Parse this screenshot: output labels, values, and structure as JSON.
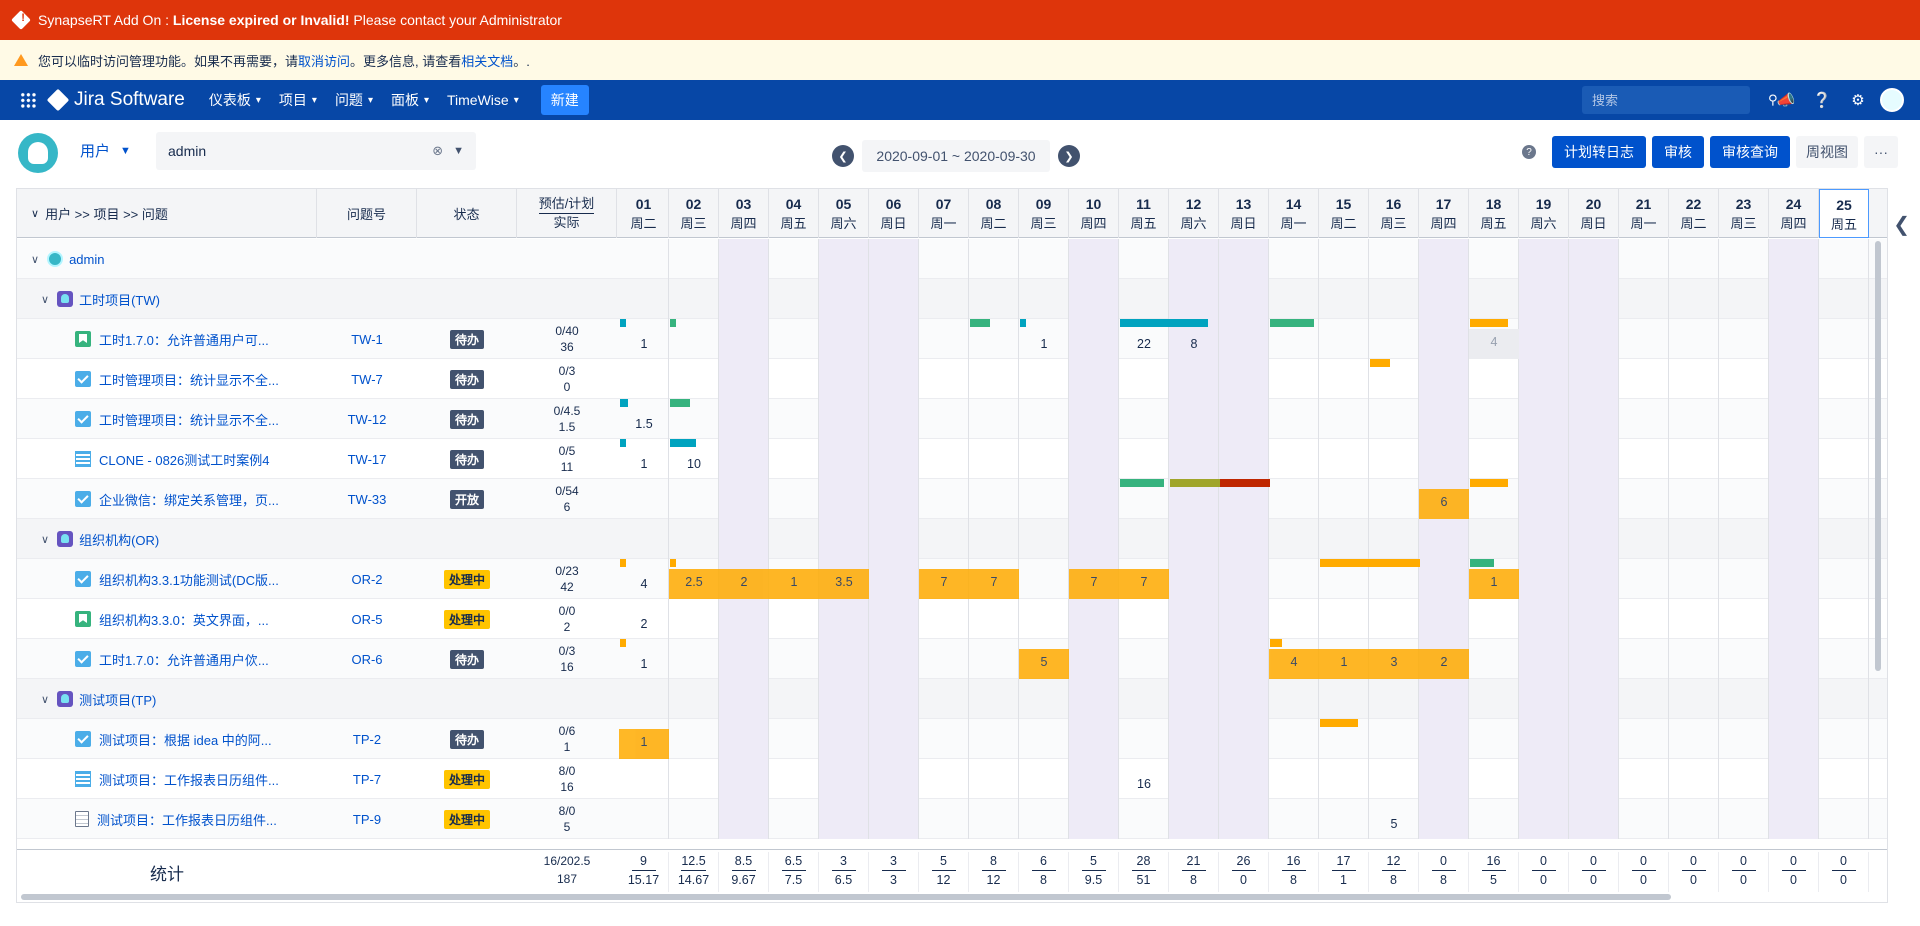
{
  "alerts": {
    "license_prefix": "SynapseRT Add On : ",
    "license_bold": "License expired or Invalid!",
    "license_suffix": " Please contact your Administrator",
    "temp_access_a": "您可以临时访问管理功能。如果不再需要，请 ",
    "temp_access_link1": "取消访问",
    "temp_access_b": "。更多信息, 请查看 ",
    "temp_access_link2": "相关文档",
    "temp_access_c": "。."
  },
  "nav": {
    "product": "Jira Software",
    "items": [
      "仪表板",
      "项目",
      "问题",
      "面板",
      "TimeWise"
    ],
    "create": "新建",
    "search_placeholder": "搜索"
  },
  "toolbar": {
    "user_mode": "用户",
    "user_value": "admin",
    "date_range": "2020-09-01 ~ 2020-09-30",
    "help": "?",
    "buttons": [
      "计划转日志",
      "审核",
      "审核查询"
    ],
    "week_view": "周视图",
    "more": "···"
  },
  "table": {
    "headers": {
      "tree": "用户 >> 项目 >> 问题",
      "key": "问题号",
      "status": "状态",
      "est_top": "预估/计划",
      "est_bottom": "实际"
    },
    "days": [
      {
        "d": "01",
        "w": "周二"
      },
      {
        "d": "02",
        "w": "周三"
      },
      {
        "d": "03",
        "w": "周四"
      },
      {
        "d": "04",
        "w": "周五"
      },
      {
        "d": "05",
        "w": "周六"
      },
      {
        "d": "06",
        "w": "周日"
      },
      {
        "d": "07",
        "w": "周一"
      },
      {
        "d": "08",
        "w": "周二"
      },
      {
        "d": "09",
        "w": "周三"
      },
      {
        "d": "10",
        "w": "周四"
      },
      {
        "d": "11",
        "w": "周五"
      },
      {
        "d": "12",
        "w": "周六"
      },
      {
        "d": "13",
        "w": "周日"
      },
      {
        "d": "14",
        "w": "周一"
      },
      {
        "d": "15",
        "w": "周二"
      },
      {
        "d": "16",
        "w": "周三"
      },
      {
        "d": "17",
        "w": "周四"
      },
      {
        "d": "18",
        "w": "周五"
      },
      {
        "d": "19",
        "w": "周六"
      },
      {
        "d": "20",
        "w": "周日"
      },
      {
        "d": "21",
        "w": "周一"
      },
      {
        "d": "22",
        "w": "周二"
      },
      {
        "d": "23",
        "w": "周三"
      },
      {
        "d": "24",
        "w": "周四"
      },
      {
        "d": "25",
        "w": "周五"
      }
    ],
    "rows": [
      {
        "kind": "user",
        "title": "admin"
      },
      {
        "kind": "project",
        "title": "工时项目(TW)"
      },
      {
        "kind": "issue",
        "type": "story",
        "title": "工时1.7.0：允许普通用户可...",
        "key": "TW-1",
        "status": "待办",
        "lz": "todo",
        "est": "0/40",
        "act": "36",
        "vals": {
          "0": "1",
          "8": "1",
          "10": "22",
          "11": "8"
        },
        "grey": {
          "17": "4"
        },
        "fills": [],
        "bars": [
          {
            "i": 0,
            "c": "teal",
            "w": 6
          },
          {
            "i": 1,
            "c": "green",
            "w": 6
          },
          {
            "i": 7,
            "c": "green",
            "w": 20
          },
          {
            "i": 8,
            "c": "teal",
            "w": 6
          },
          {
            "i": 10,
            "c": "teal",
            "w": 50
          },
          {
            "i": 11,
            "c": "teal",
            "w": 38
          },
          {
            "i": 13,
            "c": "green",
            "w": 44
          },
          {
            "i": 17,
            "c": "orange",
            "w": 38
          }
        ]
      },
      {
        "kind": "issue",
        "type": "task",
        "title": "工时管理项目：统计显示不全...",
        "key": "TW-7",
        "status": "待办",
        "lz": "todo",
        "est": "0/3",
        "act": "0",
        "vals": {},
        "grey": {},
        "fills": [],
        "bars": [
          {
            "i": 15,
            "c": "orange",
            "w": 20
          }
        ]
      },
      {
        "kind": "issue",
        "type": "task",
        "title": "工时管理项目：统计显示不全...",
        "key": "TW-12",
        "status": "待办",
        "lz": "todo",
        "est": "0/4.5",
        "act": "1.5",
        "vals": {
          "0": "1.5"
        },
        "grey": {},
        "fills": [],
        "bars": [
          {
            "i": 0,
            "c": "teal",
            "w": 8
          },
          {
            "i": 1,
            "c": "green",
            "w": 20
          }
        ]
      },
      {
        "kind": "issue",
        "type": "list",
        "title": "CLONE - 0826测试工时案例4",
        "key": "TW-17",
        "status": "待办",
        "lz": "todo",
        "est": "0/5",
        "act": "11",
        "vals": {
          "0": "1",
          "1": "10"
        },
        "grey": {},
        "fills": [],
        "bars": [
          {
            "i": 0,
            "c": "teal",
            "w": 6
          },
          {
            "i": 1,
            "c": "teal",
            "w": 26
          }
        ]
      },
      {
        "kind": "issue",
        "type": "task",
        "title": "企业微信：绑定关系管理，页...",
        "key": "TW-33",
        "status": "开放",
        "lz": "open",
        "est": "0/54",
        "act": "6",
        "vals": {},
        "grey": {},
        "fills": [
          {
            "i": 16,
            "v": "6"
          }
        ],
        "bars": [
          {
            "i": 10,
            "c": "green",
            "w": 44
          },
          {
            "i": 11,
            "c": "olive",
            "w": 50
          },
          {
            "i": 12,
            "c": "red",
            "w": 50
          },
          {
            "i": 17,
            "c": "orange",
            "w": 38
          }
        ]
      },
      {
        "kind": "project",
        "title": "组织机构(OR)"
      },
      {
        "kind": "issue",
        "type": "task",
        "title": "组织机构3.3.1功能测试(DC版...",
        "key": "OR-2",
        "status": "处理中",
        "lz": "prog",
        "est": "0/23",
        "act": "42",
        "vals": {
          "0": "4"
        },
        "grey": {},
        "fills": [
          {
            "i": 1,
            "v": "2.5"
          },
          {
            "i": 2,
            "v": "2"
          },
          {
            "i": 3,
            "v": "1"
          },
          {
            "i": 4,
            "v": "3.5"
          },
          {
            "i": 6,
            "v": "7"
          },
          {
            "i": 7,
            "v": "7"
          },
          {
            "i": 9,
            "v": "7"
          },
          {
            "i": 10,
            "v": "7"
          },
          {
            "i": 17,
            "v": "1"
          }
        ],
        "bars": [
          {
            "i": 0,
            "c": "orange",
            "w": 6
          },
          {
            "i": 1,
            "c": "orange",
            "w": 6
          },
          {
            "i": 14,
            "c": "orange",
            "w": 50
          },
          {
            "i": 15,
            "c": "orange",
            "w": 50
          },
          {
            "i": 17,
            "c": "green",
            "w": 24
          }
        ]
      },
      {
        "kind": "issue",
        "type": "story",
        "title": "组织机构3.3.0：英文界面，...",
        "key": "OR-5",
        "status": "处理中",
        "lz": "prog",
        "est": "0/0",
        "act": "2",
        "vals": {
          "0": "2"
        },
        "grey": {},
        "fills": [],
        "bars": []
      },
      {
        "kind": "issue",
        "type": "task",
        "title": "工时1.7.0：允许普通用户佽...",
        "key": "OR-6",
        "status": "待办",
        "lz": "todo",
        "est": "0/3",
        "act": "16",
        "vals": {
          "0": "1"
        },
        "grey": {},
        "fills": [
          {
            "i": 8,
            "v": "5"
          },
          {
            "i": 13,
            "v": "4"
          },
          {
            "i": 14,
            "v": "1"
          },
          {
            "i": 15,
            "v": "3"
          },
          {
            "i": 16,
            "v": "2"
          }
        ],
        "bars": [
          {
            "i": 0,
            "c": "orange",
            "w": 6
          },
          {
            "i": 13,
            "c": "orange",
            "w": 12
          }
        ]
      },
      {
        "kind": "project",
        "title": "测试项目(TP)"
      },
      {
        "kind": "issue",
        "type": "task",
        "title": "测试项目：根据 idea 中的阿...",
        "key": "TP-2",
        "status": "待办",
        "lz": "todo",
        "est": "0/6",
        "act": "1",
        "vals": {},
        "grey": {},
        "fills": [
          {
            "i": 0,
            "v": "1"
          }
        ],
        "bars": [
          {
            "i": 14,
            "c": "orange",
            "w": 38
          }
        ]
      },
      {
        "kind": "issue",
        "type": "list",
        "title": "测试项目：工作报表日历组件...",
        "key": "TP-7",
        "status": "处理中",
        "lz": "prog",
        "est": "8/0",
        "act": "16",
        "vals": {
          "10": "16"
        },
        "grey": {},
        "fills": [],
        "bars": []
      },
      {
        "kind": "issue",
        "type": "doc",
        "title": "测试项目：工作报表日历组件...",
        "key": "TP-9",
        "status": "处理中",
        "lz": "prog",
        "est": "8/0",
        "act": "5",
        "vals": {
          "15": "5"
        },
        "grey": {},
        "fills": [],
        "bars": []
      }
    ],
    "footer": {
      "label": "统计",
      "total_top": "16/202.5",
      "total_bottom": "187",
      "days_top": [
        "9",
        "12.5",
        "8.5",
        "6.5",
        "3",
        "3",
        "5",
        "8",
        "6",
        "5",
        "28",
        "21",
        "26",
        "16",
        "17",
        "12",
        "0",
        "16",
        "0",
        "0",
        "0",
        "0",
        "0",
        "0",
        "0"
      ],
      "days_bottom": [
        "15.17",
        "14.67",
        "9.67",
        "7.5",
        "6.5",
        "3",
        "12",
        "12",
        "8",
        "9.5",
        "51",
        "8",
        "0",
        "8",
        "1",
        "8",
        "8",
        "5",
        "0",
        "0",
        "0",
        "0",
        "0",
        "0",
        "0"
      ]
    }
  }
}
